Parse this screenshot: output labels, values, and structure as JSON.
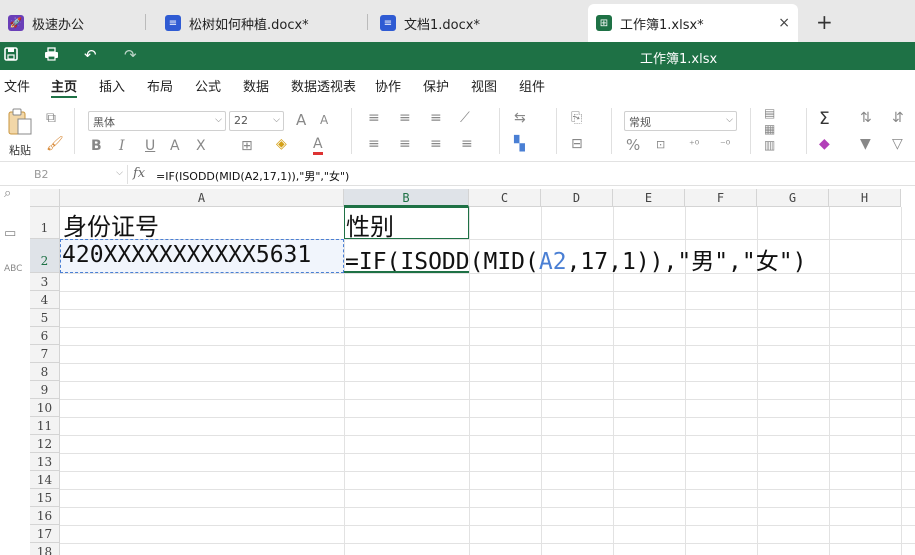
{
  "tabs": [
    {
      "label": "极速办公",
      "icon": "rocket-icon",
      "color": "#6a3fb8"
    },
    {
      "label": "松树如何种植.docx*",
      "icon": "document-icon",
      "color": "#2f5bd3"
    },
    {
      "label": "文档1.docx*",
      "icon": "document-icon",
      "color": "#2f5bd3"
    },
    {
      "label": "工作簿1.xlsx*",
      "icon": "spreadsheet-icon",
      "color": "#1e7145",
      "active": true,
      "close": "×"
    }
  ],
  "new_tab": "+",
  "window_title": "工作簿1.xlsx",
  "menu": [
    "文件",
    "主页",
    "插入",
    "布局",
    "公式",
    "数据",
    "数据透视表",
    "协作",
    "保护",
    "视图",
    "组件"
  ],
  "menu_active": "主页",
  "ribbon": {
    "paste_label": "粘贴",
    "font_name": "黑体",
    "font_size": "22",
    "number_format": "常规",
    "bold": "B",
    "italic": "I",
    "underline": "U",
    "strike": "A",
    "sub": "X",
    "grow_font": "A",
    "shrink_font": "A",
    "font_color": "A",
    "percent": "%",
    "sum": "Σ"
  },
  "formula_bar": {
    "cell_ref": "B2",
    "fx": "fx",
    "formula": "=IF(ISODD(MID(A2,17,1)),\"男\",\"女\")"
  },
  "columns": [
    "A",
    "B",
    "C",
    "D",
    "E",
    "F",
    "G",
    "H"
  ],
  "rows": [
    "1",
    "2",
    "3",
    "4",
    "5",
    "6",
    "7",
    "8",
    "9",
    "10",
    "11",
    "12",
    "13",
    "14",
    "15",
    "16",
    "17",
    "18"
  ],
  "cells": {
    "A1": "身份证号",
    "B1": "性别",
    "A2": "420XXXXXXXXXXX5631",
    "B2_prefix": "=IF(ISODD(MID(",
    "B2_ref": "A2",
    "B2_suffix": ",17,1)),\"男\",\"女\")"
  },
  "colors": {
    "accent": "#1e7145",
    "ref": "#4a7fd4"
  }
}
